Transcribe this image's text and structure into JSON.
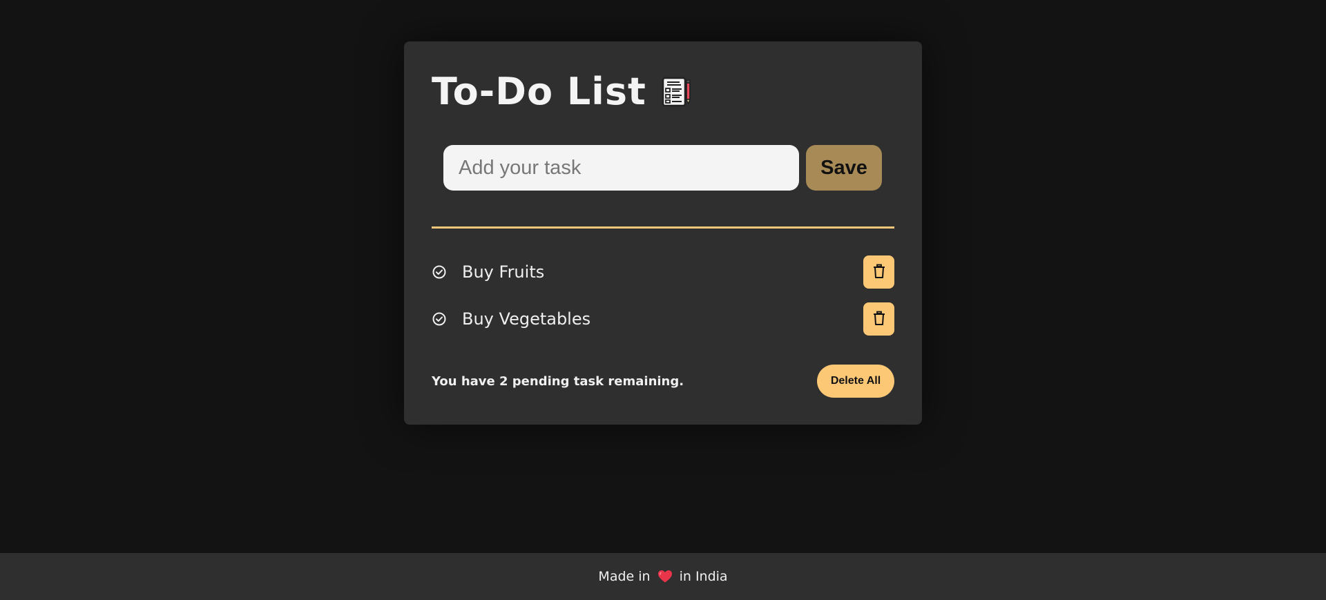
{
  "app": {
    "title": "To-Do List",
    "title_icon": "notepad-checklist-icon"
  },
  "input": {
    "placeholder": "Add your task",
    "value": "",
    "save_label": "Save"
  },
  "tasks": [
    {
      "label": "Buy Fruits",
      "status_icon": "check-circle-icon",
      "action_icon": "trash-icon"
    },
    {
      "label": "Buy Vegetables",
      "status_icon": "check-circle-icon",
      "action_icon": "trash-icon"
    }
  ],
  "summary": {
    "pending_text": "You have 2 pending task remaining.",
    "delete_all_label": "Delete All"
  },
  "footer": {
    "prefix": "Made in",
    "icon": "heart-icon",
    "suffix": "in India"
  },
  "colors": {
    "background": "#131313",
    "card": "#2f2f2f",
    "accent": "#fcc876",
    "save_button": "#a88a57",
    "heart": "#e8354a"
  }
}
